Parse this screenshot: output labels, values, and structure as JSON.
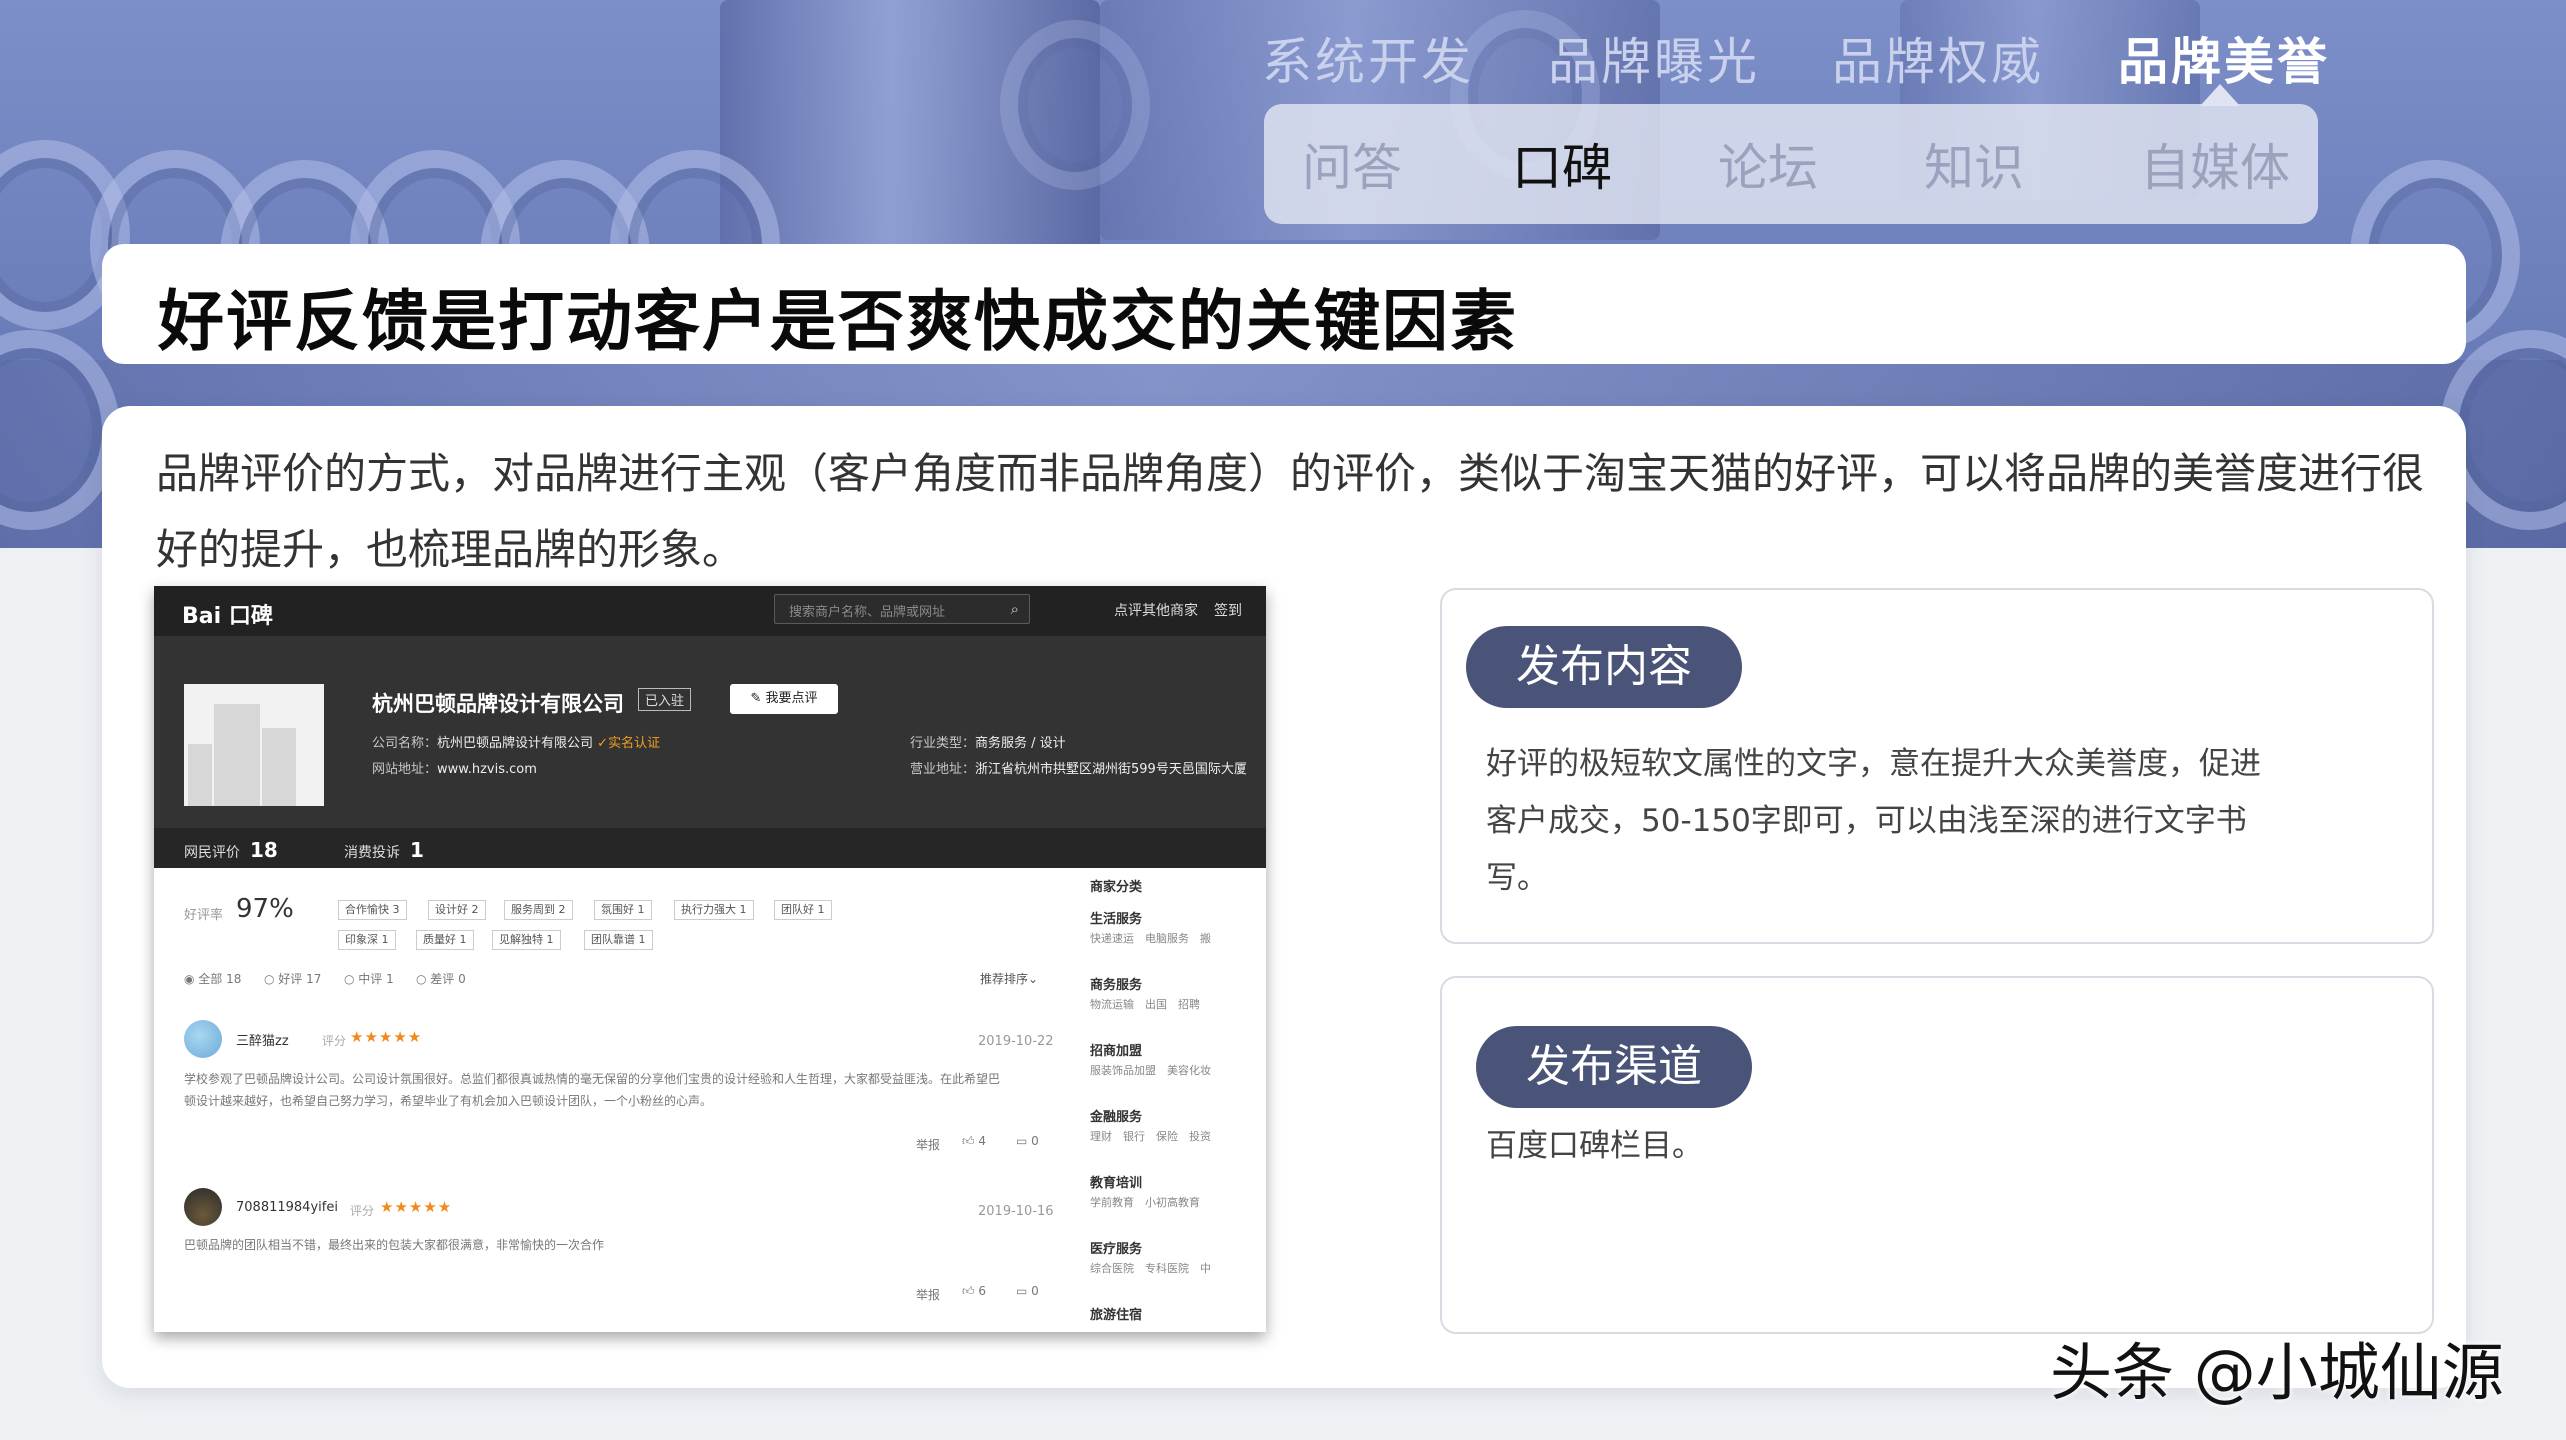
{
  "nav": {
    "top": [
      "系统开发",
      "品牌曝光",
      "品牌权威",
      "品牌美誉"
    ],
    "sub": [
      "问答",
      "口碑",
      "论坛",
      "知识",
      "自媒体"
    ]
  },
  "title": "好评反馈是打动客户是否爽快成交的关键因素",
  "intro": "品牌评价的方式，对品牌进行主观（客户角度而非品牌角度）的评价，类似于淘宝天猫的好评，可以将品牌的美誉度进行很好的提升，也梳理品牌的形象。",
  "koubei": {
    "logo": "Bai 口碑",
    "search_placeholder": "搜索商户名称、品牌或网址",
    "links": [
      "点评其他商家",
      "签到"
    ],
    "company": "杭州巴顿品牌设计有限公司",
    "joined_badge": "已入驻",
    "review_button": "我要点评",
    "company_label": "公司名称：",
    "company_value": "杭州巴顿品牌设计有限公司",
    "verified": "实名认证",
    "website_label": "网站地址：",
    "website_value": "www.hzvis.com",
    "industry_label": "行业类型：",
    "industry_value": "商务服务 / 设计",
    "address_label": "营业地址：",
    "address_value": "浙江省杭州市拱墅区湖州街599号天邑国际大厦",
    "stat_reviews_label": "网民评价",
    "stat_reviews": "18",
    "stat_complaints_label": "消费投诉",
    "stat_complaints": "1",
    "rate_label": "好评率",
    "rate": "97%",
    "tags": [
      "合作愉快 3",
      "设计好 2",
      "服务周到 2",
      "氛围好 1",
      "执行力强大 1",
      "团队好 1",
      "印象深 1",
      "质量好 1",
      "见解独特 1",
      "团队靠谱 1"
    ],
    "filters": [
      "全部 18",
      "好评 17",
      "中评 1",
      "差评 0"
    ],
    "sort": "推荐排序",
    "reviews": [
      {
        "user": "三醉猫zz",
        "score_label": "评分",
        "stars": "★★★★★",
        "date": "2019-10-22",
        "text": "学校参观了巴顿品牌设计公司。公司设计氛围很好。总监们都很真诚热情的毫无保留的分享他们宝贵的设计经验和人生哲理，大家都受益匪浅。在此希望巴顿设计越来越好，也希望自己努力学习，希望毕业了有机会加入巴顿设计团队，一个小粉丝的心声。",
        "report": "举报",
        "likes": "4",
        "comments": "0"
      },
      {
        "user": "708811984yifei",
        "score_label": "评分",
        "stars": "★★★★★",
        "date": "2019-10-16",
        "text": "巴顿品牌的团队相当不错，最终出来的包装大家都很满意，非常愉快的一次合作",
        "report": "举报",
        "likes": "6",
        "comments": "0"
      }
    ],
    "side_title": "商家分类",
    "categories": [
      {
        "name": "生活服务",
        "sub": "快递速运　电脑服务　搬"
      },
      {
        "name": "商务服务",
        "sub": "物流运输　出国　招聘"
      },
      {
        "name": "招商加盟",
        "sub": "服装饰品加盟　美容化妆"
      },
      {
        "name": "金融服务",
        "sub": "理财　银行　保险　投资"
      },
      {
        "name": "教育培训",
        "sub": "学前教育　小初高教育"
      },
      {
        "name": "医疗服务",
        "sub": "综合医院　专科医院　中"
      },
      {
        "name": "旅游住宿",
        "sub": ""
      }
    ]
  },
  "panel1": {
    "title": "发布内容",
    "text": "好评的极短软文属性的文字，意在提升大众美誉度，促进客户成交，50-150字即可，可以由浅至深的进行文字书写。"
  },
  "panel2": {
    "title": "发布渠道",
    "text": "百度口碑栏目。"
  },
  "watermark": "头条 @小城仙源"
}
